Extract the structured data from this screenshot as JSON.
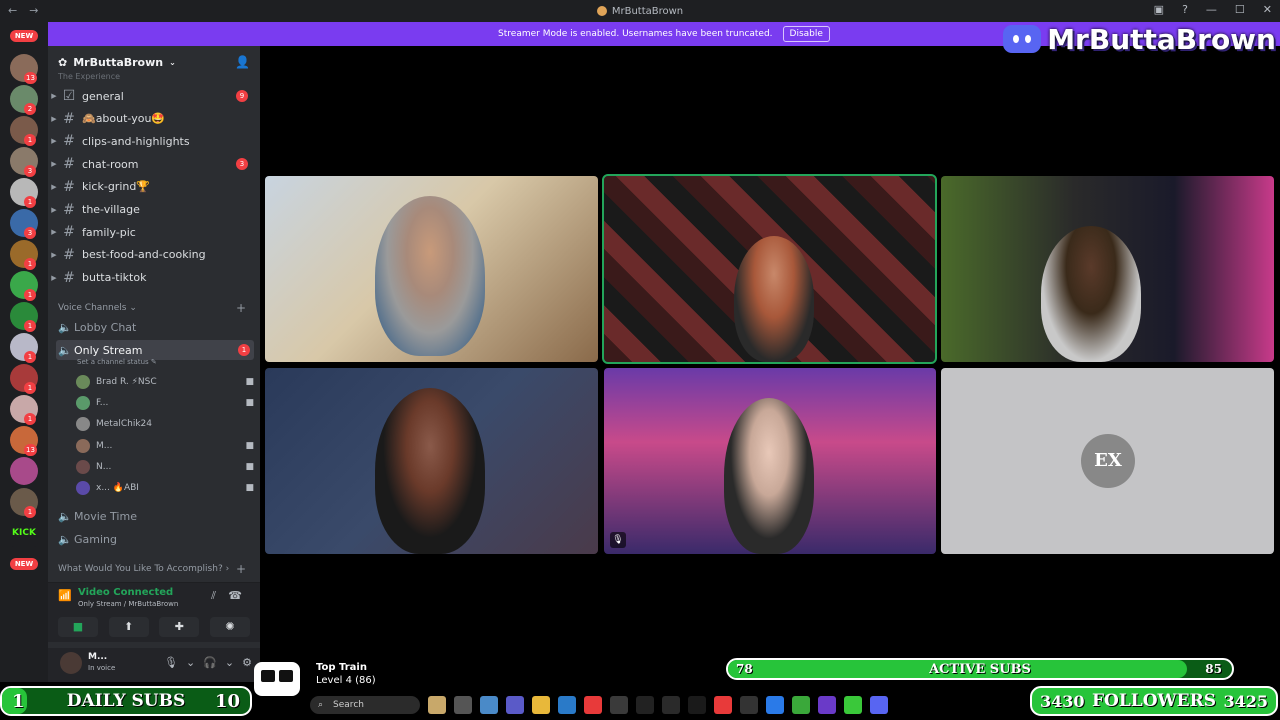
{
  "window": {
    "title": "MrButtaBrown"
  },
  "banner": {
    "message": "Streamer Mode is enabled. Usernames have been truncated.",
    "disable_label": "Disable"
  },
  "overlay_brand": "MrButtaBrown",
  "server_rail": {
    "icons": [
      {
        "color": "#8a6b5a",
        "badge": "13"
      },
      {
        "color": "#6a8a6a",
        "badge": "2"
      },
      {
        "color": "#7a5a4a",
        "badge": "1"
      },
      {
        "color": "#8a7a6a",
        "badge": "3"
      },
      {
        "color": "#b8b8b8",
        "badge": "1"
      },
      {
        "color": "#3a6aa8",
        "badge": "3"
      },
      {
        "color": "#9a6a2a",
        "badge": "1"
      },
      {
        "color": "#3aa84a",
        "badge": "1"
      },
      {
        "color": "#2a8a3a",
        "badge": "1"
      },
      {
        "color": "#b8b8c8",
        "badge": "1"
      },
      {
        "color": "#a83a3a",
        "badge": "1"
      },
      {
        "color": "#c8a8a8",
        "badge": "1"
      },
      {
        "color": "#c8683a",
        "badge": "13"
      },
      {
        "color": "#a84a8a",
        "badge": ""
      },
      {
        "color": "#6a5a4a",
        "badge": "1"
      },
      {
        "color": "#1e1f22",
        "badge": "",
        "label": "KICK"
      }
    ],
    "new_label": "NEW"
  },
  "sidebar": {
    "server_name": "MrButtaBrown",
    "partial_category": "The Experience",
    "text_channels": [
      {
        "name": "general",
        "badge": "9",
        "icon": "rules-icon"
      },
      {
        "name": "🙈about-you🤩",
        "badge": ""
      },
      {
        "name": "clips-and-highlights",
        "badge": ""
      },
      {
        "name": "chat-room",
        "badge": "3"
      },
      {
        "name": "kick-grind🏆",
        "badge": ""
      },
      {
        "name": "the-village",
        "badge": ""
      },
      {
        "name": "family-pic",
        "badge": ""
      },
      {
        "name": "best-food-and-cooking",
        "badge": ""
      },
      {
        "name": "butta-tiktok",
        "badge": ""
      }
    ],
    "voice_category": "Voice Channels",
    "voice_channels": {
      "lobby": "Lobby Chat",
      "only_stream": "Only Stream",
      "only_stream_badge": "1",
      "status_placeholder": "Set a channel status",
      "movie": "Movie Time",
      "gaming": "Gaming"
    },
    "members": [
      {
        "name": "Brad R. ⚡NSC",
        "color": "#6a8a5a"
      },
      {
        "name": "F...",
        "color": "#5a9a6a"
      },
      {
        "name": "MetalChik24",
        "color": "#888888"
      },
      {
        "name": "M...",
        "color": "#8a6a5a"
      },
      {
        "name": "N...",
        "color": "#6a4a4a"
      },
      {
        "name": "x... 🔥ABI",
        "color": "#5a4aa8"
      }
    ],
    "accomplish_category": "What Would You Like To Accomplish?"
  },
  "voice_connected": {
    "title": "Video Connected",
    "subtitle": "Only Stream / MrButtaBrown"
  },
  "user_panel": {
    "name": "M...",
    "status": "In voice"
  },
  "overlays": {
    "active_subs": {
      "left": "78",
      "label": "ACTIVE SUBS",
      "right": "85",
      "fill_fraction": 0.91
    },
    "daily_subs": {
      "left": "1",
      "label": "DAILY SUBS",
      "right": "10",
      "fill_fraction": 0.1
    },
    "followers": {
      "left": "3430",
      "label": "FOLLOWERS",
      "right": "3425"
    },
    "train": {
      "title": "Top Train",
      "level": "Level 4 (86)"
    }
  },
  "taskbar": {
    "search_placeholder": "Search"
  },
  "colors": {
    "accent": "#7a3cf0",
    "discord_green": "#23a55a",
    "badge_red": "#f23f43",
    "overlay_green": "#27c43a"
  }
}
